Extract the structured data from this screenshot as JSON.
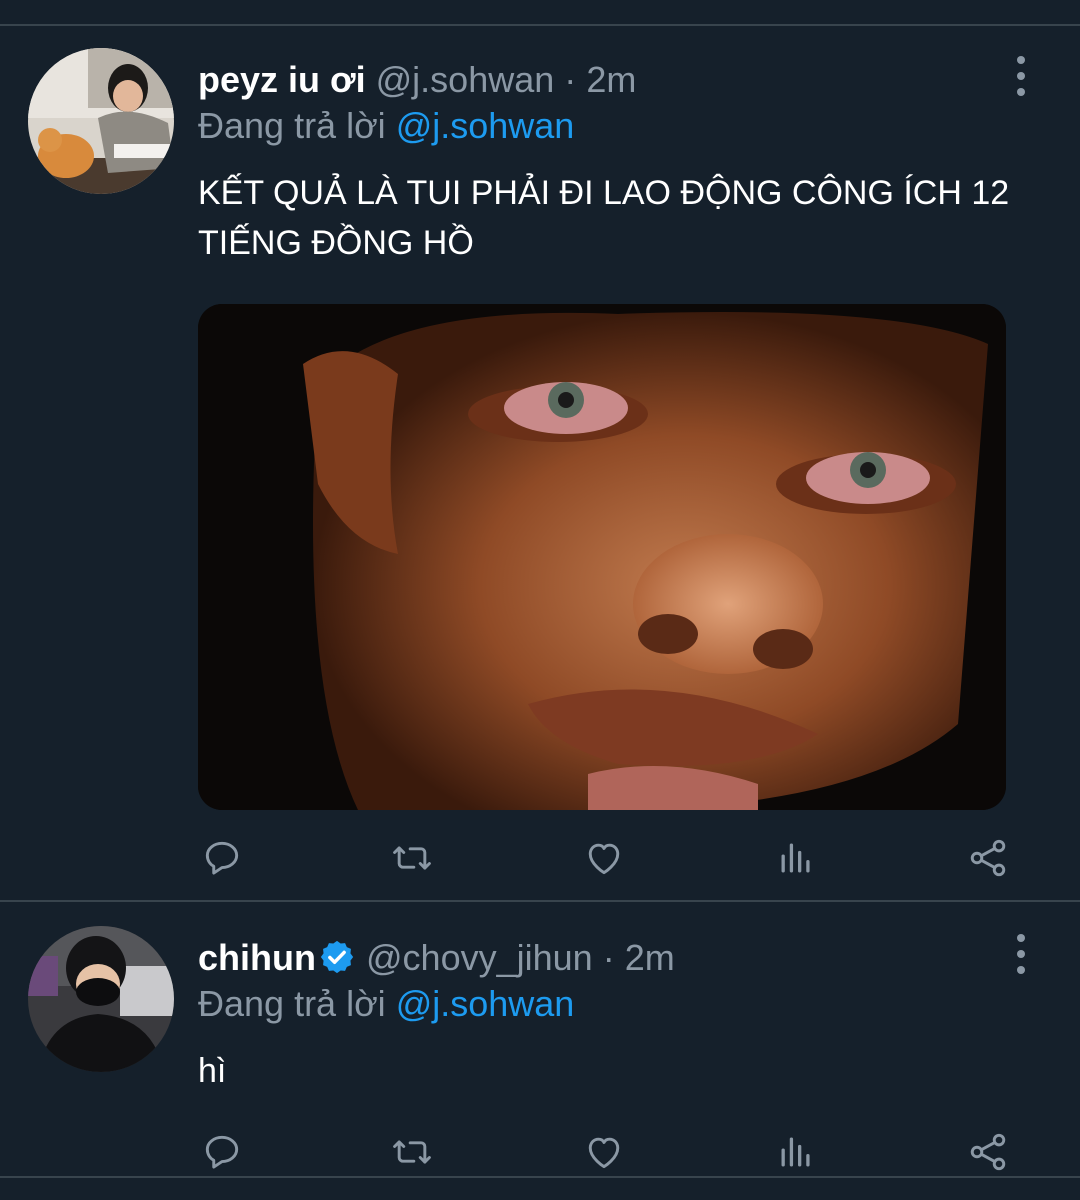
{
  "tweets": [
    {
      "display_name": "peyz iu ơi",
      "handle": "@j.sohwan",
      "separator": "·",
      "time": "2m",
      "reply_prefix": "Đang trả lời",
      "reply_to": "@j.sohwan",
      "text": "KẾT QUẢ LÀ TUI PHẢI ĐI LAO ĐỘNG CÔNG ÍCH 12 TIẾNG ĐỒNG HỒ",
      "has_media": true,
      "verified": false
    },
    {
      "display_name": "chihun",
      "handle": "@chovy_jihun",
      "separator": "·",
      "time": "2m",
      "reply_prefix": "Đang trả lời",
      "reply_to": "@j.sohwan",
      "text": "hì",
      "has_media": false,
      "verified": true
    }
  ],
  "actions": [
    "reply-icon",
    "retweet-icon",
    "like-icon",
    "analytics-icon",
    "share-icon"
  ],
  "colors": {
    "background": "#15202b",
    "divider": "#38444d",
    "secondary_text": "#8b98a5",
    "accent": "#1d9bf0"
  }
}
